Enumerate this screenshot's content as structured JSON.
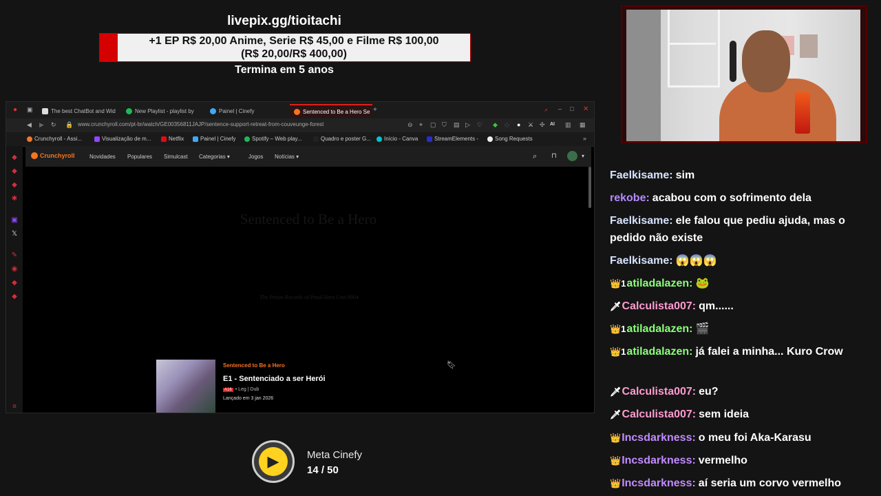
{
  "overlay": {
    "livepix": "livepix.gg/tioitachi",
    "price_line1": "+1 EP R$ 20,00 Anime, Serie R$ 45,00 e Filme R$ 100,00",
    "price_line2": "(R$ 20,00/R$ 400,00)",
    "ends": "Termina em 5 anos",
    "accent": "#d50000"
  },
  "browser": {
    "tabs": [
      {
        "label": "The best ChatBot and Wid"
      },
      {
        "label": "New Playlist - playlist by"
      },
      {
        "label": "Painel | Cinefy"
      },
      {
        "label": "Sentenced to Be a Hero Se"
      }
    ],
    "url": "www.crunchyroll.com/pt-br/watch/GE00356811JAJP/sentence-support-retreat-from-couveunge-forest",
    "bookmarks": [
      "Crunchyroll - Assi...",
      "Visualização de m...",
      "Netflix",
      "Painel | Cinefy",
      "Spotify – Web play...",
      "Quadro e poster G...",
      "Início - Canva",
      "StreamElements -",
      "Song Requests"
    ],
    "ai_label": "AI"
  },
  "crunchyroll": {
    "logo": "Crunchyroll",
    "nav": [
      "Novidades",
      "Populares",
      "Simulcast",
      "Categorias",
      "Jogos",
      "Notícias"
    ],
    "ghost_title": "Sentenced to Be a Hero",
    "ghost_subtitle": "The Prison Records of Penal Hero Unit 9004",
    "episode": {
      "series": "Sentenced to Be a Hero",
      "title": "E1 - Sentenciado a ser Herói",
      "rating": "A16",
      "lang": "• Leg | Dub",
      "date": "Lançado em 3 jan 2026"
    },
    "accent": "#f47521"
  },
  "meta": {
    "label": "Meta Cinefy",
    "count": "14 / 50"
  },
  "chat": [
    {
      "user": "Faelkisame:",
      "text": "sim",
      "badge": "",
      "color": "ubl"
    },
    {
      "user": "rekobe:",
      "text": "acabou com o sofrimento dela",
      "badge": "",
      "color": "upu"
    },
    {
      "user": "Faelkisame:",
      "text": "ele falou que pediu ajuda, mas o pedido não existe",
      "badge": "",
      "color": "ubl"
    },
    {
      "user": "Faelkisame:",
      "text": "😱😱😱",
      "badge": "",
      "color": "ubl"
    },
    {
      "user": "atiladalazen:",
      "text": "🐸",
      "badge": "👑1",
      "color": "ugr"
    },
    {
      "user": "Calculista007:",
      "text": "qm......",
      "badge": "🗡",
      "color": "upk"
    },
    {
      "user": "atiladalazen:",
      "text": "🎬",
      "badge": "👑1",
      "color": "ugr"
    },
    {
      "user": "atiladalazen:",
      "text": "já falei a minha... Kuro Crow",
      "badge": "👑1",
      "color": "ugr"
    },
    {
      "user": "Calculista007:",
      "text": "eu?",
      "badge": "🗡",
      "color": "upk"
    },
    {
      "user": "Calculista007:",
      "text": "sem ideia",
      "badge": "🗡",
      "color": "upk"
    },
    {
      "user": "Incsdarkness:",
      "text": "o meu foi Aka-Karasu",
      "badge": "👑",
      "color": "uvi"
    },
    {
      "user": "Incsdarkness:",
      "text": "vermelho",
      "badge": "👑",
      "color": "uvi"
    },
    {
      "user": "Incsdarkness:",
      "text": "aí seria um corvo vermelho",
      "badge": "👑",
      "color": "uvi"
    }
  ]
}
